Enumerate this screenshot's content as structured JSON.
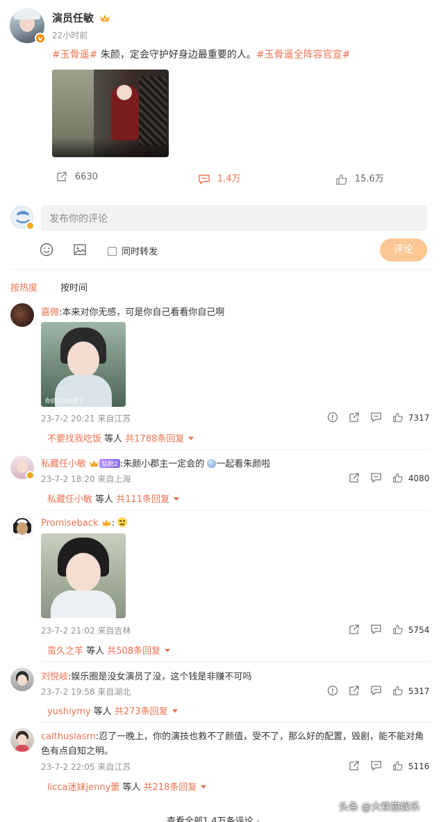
{
  "post": {
    "author": "演员任敏",
    "time": "22小时前",
    "tag1": "#玉骨遥#",
    "text": " 朱颜，定会守护好身边最重要的人。",
    "tag2": "#玉骨遥全阵容官宣#",
    "repost_count": "6630",
    "comment_count": "1.4万",
    "like_count": "15.6万"
  },
  "composer": {
    "placeholder": "发布你的评论",
    "forward_label": "同时转发",
    "submit_label": "评论"
  },
  "sort": {
    "hot_label": "按热度",
    "time_label": "按时间"
  },
  "comments": [
    {
      "name": "嘉微",
      "text": ":本来对你无感，可是你自己看看你自己啊",
      "meta": "23-7-2 20:21 来自江苏",
      "likes": "7317",
      "reply_user": "不要找我吃饭",
      "reply_mid": " 等人 ",
      "reply_count": "共1788条回复"
    },
    {
      "name": "私藏任小敏",
      "level_badge": "钻粉2",
      "text": ":朱颜小郡主一定会的",
      "text2": "一起看朱颜啦",
      "meta": "23-7-2 18:20 来自上海",
      "likes": "4080",
      "reply_user": "私藏任小敏",
      "reply_mid": " 等人 ",
      "reply_count": "共111条回复"
    },
    {
      "name": "Promiseback",
      "text": ":",
      "meta": "23-7-2 21:02 来自吉林",
      "likes": "5754",
      "reply_user": "蛮久之羊",
      "reply_mid": " 等人 ",
      "reply_count": "共508条回复"
    },
    {
      "name": "刘悦岐",
      "text": ":娱乐圈是没女演员了没，这个钱是非赚不可吗",
      "meta": "23-7-2 19:58 来自湖北",
      "likes": "5317",
      "reply_user": "yushiymy",
      "reply_mid": " 等人 ",
      "reply_count": "共273条回复"
    },
    {
      "name": "calthusiasrn",
      "text": ":忍了一晚上，你的演技也救不了颜值，受不了，那么好的配置，毁剧，能不能对角",
      "text_line2": "色有点自知之明。",
      "meta": "23-7-2 22:05 来自江苏",
      "likes": "5116",
      "reply_user": "licca迷妹jenny蕾",
      "reply_mid": " 等人 ",
      "reply_count": "共218条回复"
    }
  ],
  "footer": {
    "view_all": "查看全部1.4万条评论",
    "watermark": "头条 @大铁猫娱乐"
  },
  "image_caption": "你自以为心死了"
}
